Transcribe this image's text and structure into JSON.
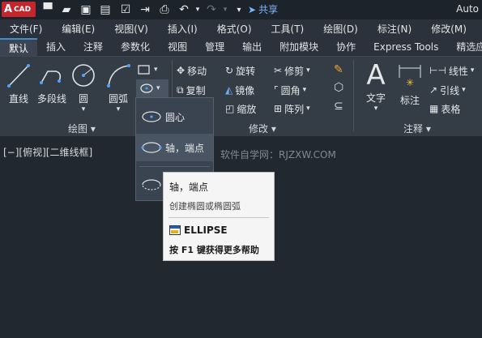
{
  "app": {
    "logo_text": "A",
    "logo_sub": "CAD",
    "title": "Auto",
    "share_label": "共享"
  },
  "menubar": [
    "文件(F)",
    "编辑(E)",
    "视图(V)",
    "插入(I)",
    "格式(O)",
    "工具(T)",
    "绘图(D)",
    "标注(N)",
    "修改(M)",
    "参"
  ],
  "tabs": [
    "默认",
    "插入",
    "注释",
    "参数化",
    "视图",
    "管理",
    "输出",
    "附加模块",
    "协作",
    "Express Tools",
    "精选应用"
  ],
  "draw": {
    "line": "直线",
    "polyline": "多段线",
    "circle": "圆",
    "arc": "圆弧",
    "panel": "绘图"
  },
  "modify": {
    "move": "移动",
    "rotate": "旋转",
    "trim": "修剪",
    "copy": "复制",
    "mirror": "镜像",
    "fillet": "圆角",
    "scale": "缩放",
    "array": "阵列",
    "panel": "修改"
  },
  "annotation": {
    "text": "文字",
    "dimension": "标注",
    "linear": "线性",
    "leader": "引线",
    "table": "表格",
    "panel": "注释"
  },
  "viewport": {
    "label": "[−][俯视][二维线框]",
    "watermark": "软件自学网：RJZXW.COM"
  },
  "dropdown": {
    "items": [
      "圆心",
      "轴，端点",
      ""
    ]
  },
  "tooltip": {
    "title": "轴，端点",
    "desc": "创建椭圆或椭圆弧",
    "command": "ELLIPSE",
    "help": "按 F1 键获得更多帮助"
  }
}
